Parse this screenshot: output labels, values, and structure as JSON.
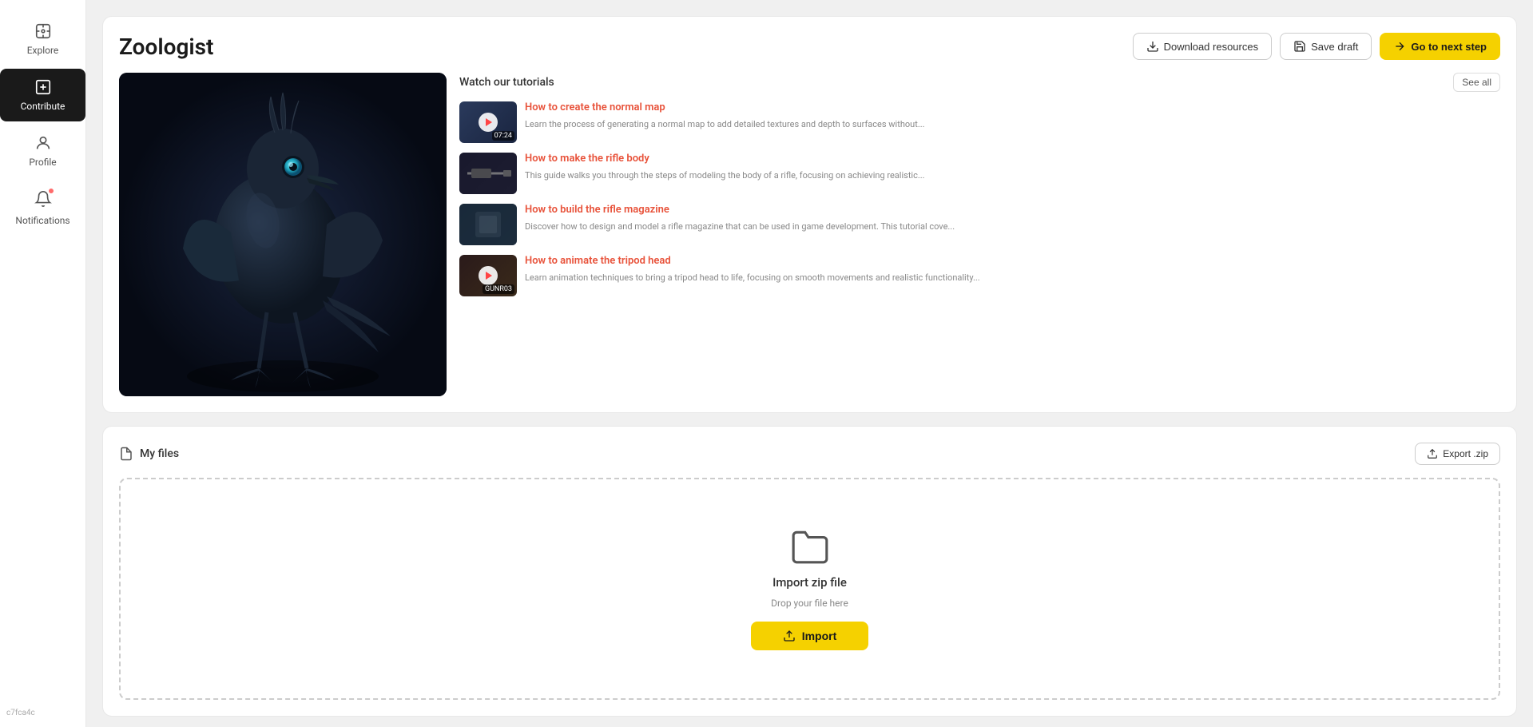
{
  "sidebar": {
    "items": [
      {
        "id": "explore",
        "label": "Explore",
        "active": false
      },
      {
        "id": "contribute",
        "label": "Contribute",
        "active": true
      },
      {
        "id": "profile",
        "label": "Profile",
        "active": false
      },
      {
        "id": "notifications",
        "label": "Notifications",
        "active": false,
        "badge": true
      }
    ],
    "version": "c7fca4c"
  },
  "header": {
    "title": "Zoologist",
    "buttons": {
      "download": "Download resources",
      "save": "Save draft",
      "next": "Go to next step"
    }
  },
  "tutorials": {
    "section_title": "Watch our tutorials",
    "see_all": "See all",
    "items": [
      {
        "title": "How to create the normal map",
        "desc": "Learn the process of generating a normal map to add detailed textures and depth to surfaces without...",
        "duration": "07:24",
        "has_play": false
      },
      {
        "title": "How to make the rifle body",
        "desc": "This guide walks you through the steps of modeling the body of a rifle, focusing on achieving realistic...",
        "duration": "",
        "has_play": false
      },
      {
        "title": "How to build the rifle magazine",
        "desc": "Discover how to design and model a rifle magazine that can be used in game development. This tutorial cove...",
        "duration": "",
        "has_play": false
      },
      {
        "title": "How to animate the tripod head",
        "desc": "Learn animation techniques to bring a tripod head to life, focusing on smooth movements and realistic functionality...",
        "duration": "GUNR03",
        "has_play": true
      }
    ]
  },
  "files": {
    "section_title": "My files",
    "export_btn": "Export .zip",
    "dropzone": {
      "title": "Import zip file",
      "subtitle": "Drop your file here",
      "import_btn": "Import"
    }
  }
}
